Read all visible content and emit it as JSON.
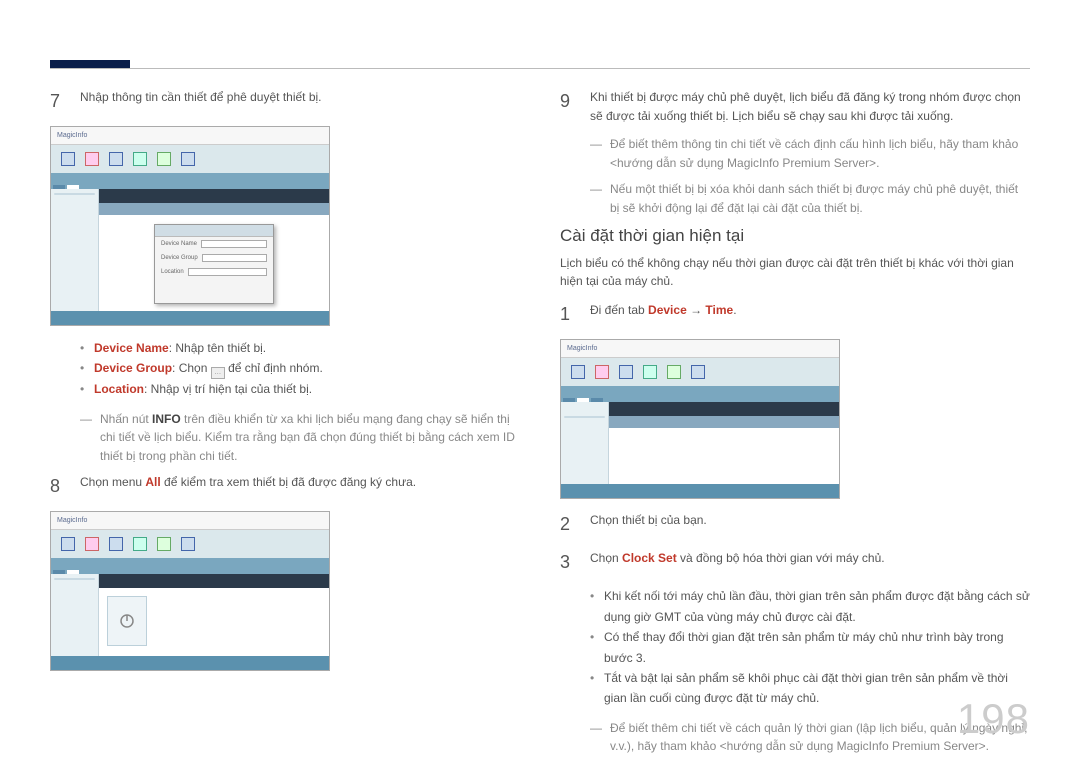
{
  "page_number": "198",
  "left": {
    "step7": {
      "num": "7",
      "text": "Nhập thông tin cần thiết để phê duyệt thiết bị."
    },
    "screenshot1_brand": "MagicInfo",
    "bullets": {
      "device_name_label": "Device Name",
      "device_name_text": ": Nhập tên thiết bị.",
      "device_group_label": "Device Group",
      "device_group_text_a": ": Chọn ",
      "device_group_text_b": " để chỉ định nhóm.",
      "location_label": "Location",
      "location_text": ": Nhập vị trí hiện tại của thiết bị."
    },
    "dash1": "Nhấn nút INFO trên điều khiển từ xa khi lịch biểu mạng đang chạy sẽ hiển thị chi tiết về lịch biểu. Kiểm tra rằng bạn đã chọn đúng thiết bị bằng cách xem ID thiết bị trong phần chi tiết.",
    "dash1_bold": "INFO",
    "step8": {
      "num": "8",
      "text_a": "Chọn menu ",
      "text_hl": "All",
      "text_b": " để kiểm tra xem thiết bị đã được đăng ký chưa."
    }
  },
  "right": {
    "step9": {
      "num": "9",
      "text": "Khi thiết bị được máy chủ phê duyệt, lịch biểu đã đăng ký trong nhóm được chọn sẽ được tải xuống thiết bị. Lịch biểu sẽ chạy sau khi được tải xuống."
    },
    "dash_a": "Để biết thêm thông tin chi tiết về cách định cấu hình lịch biểu, hãy tham khảo <hướng dẫn sử dụng MagicInfo Premium Server>.",
    "dash_b": "Nếu một thiết bị bị xóa khỏi danh sách thiết bị được máy chủ phê duyệt, thiết bị sẽ khởi động lại để đặt lại cài đặt của thiết bị.",
    "section_title": "Cài đặt thời gian hiện tại",
    "section_intro": "Lịch biểu có thể không chạy nếu thời gian được cài đặt trên thiết bị khác với thời gian hiện tại của máy chủ.",
    "step1": {
      "num": "1",
      "text_a": "Đi đến tab ",
      "hl_a": "Device",
      "arrow": " → ",
      "hl_b": "Time",
      "period": "."
    },
    "screenshot3_brand": "MagicInfo",
    "step2": {
      "num": "2",
      "text": "Chọn thiết bị của bạn."
    },
    "step3": {
      "num": "3",
      "text_a": "Chọn ",
      "hl": "Clock Set",
      "text_b": " và đồng bộ hóa thời gian với máy chủ."
    },
    "bullets2": {
      "b1": "Khi kết nối tới máy chủ lần đầu, thời gian trên sản phẩm được đặt bằng cách sử dụng giờ GMT của vùng máy chủ được cài đặt.",
      "b2": "Có thể thay đổi thời gian đặt trên sản phẩm từ máy chủ như trình bày trong bước 3.",
      "b3": "Tắt và bật lại sản phẩm sẽ khôi phục cài đặt thời gian trên sản phẩm về thời gian lần cuối cùng được đặt từ máy chủ."
    },
    "dash_c": "Để biết thêm chi tiết về cách quản lý thời gian (lập lịch biểu, quản lý ngày nghỉ, v.v.), hãy tham khảo <hướng dẫn sử dụng MagicInfo Premium Server>."
  }
}
